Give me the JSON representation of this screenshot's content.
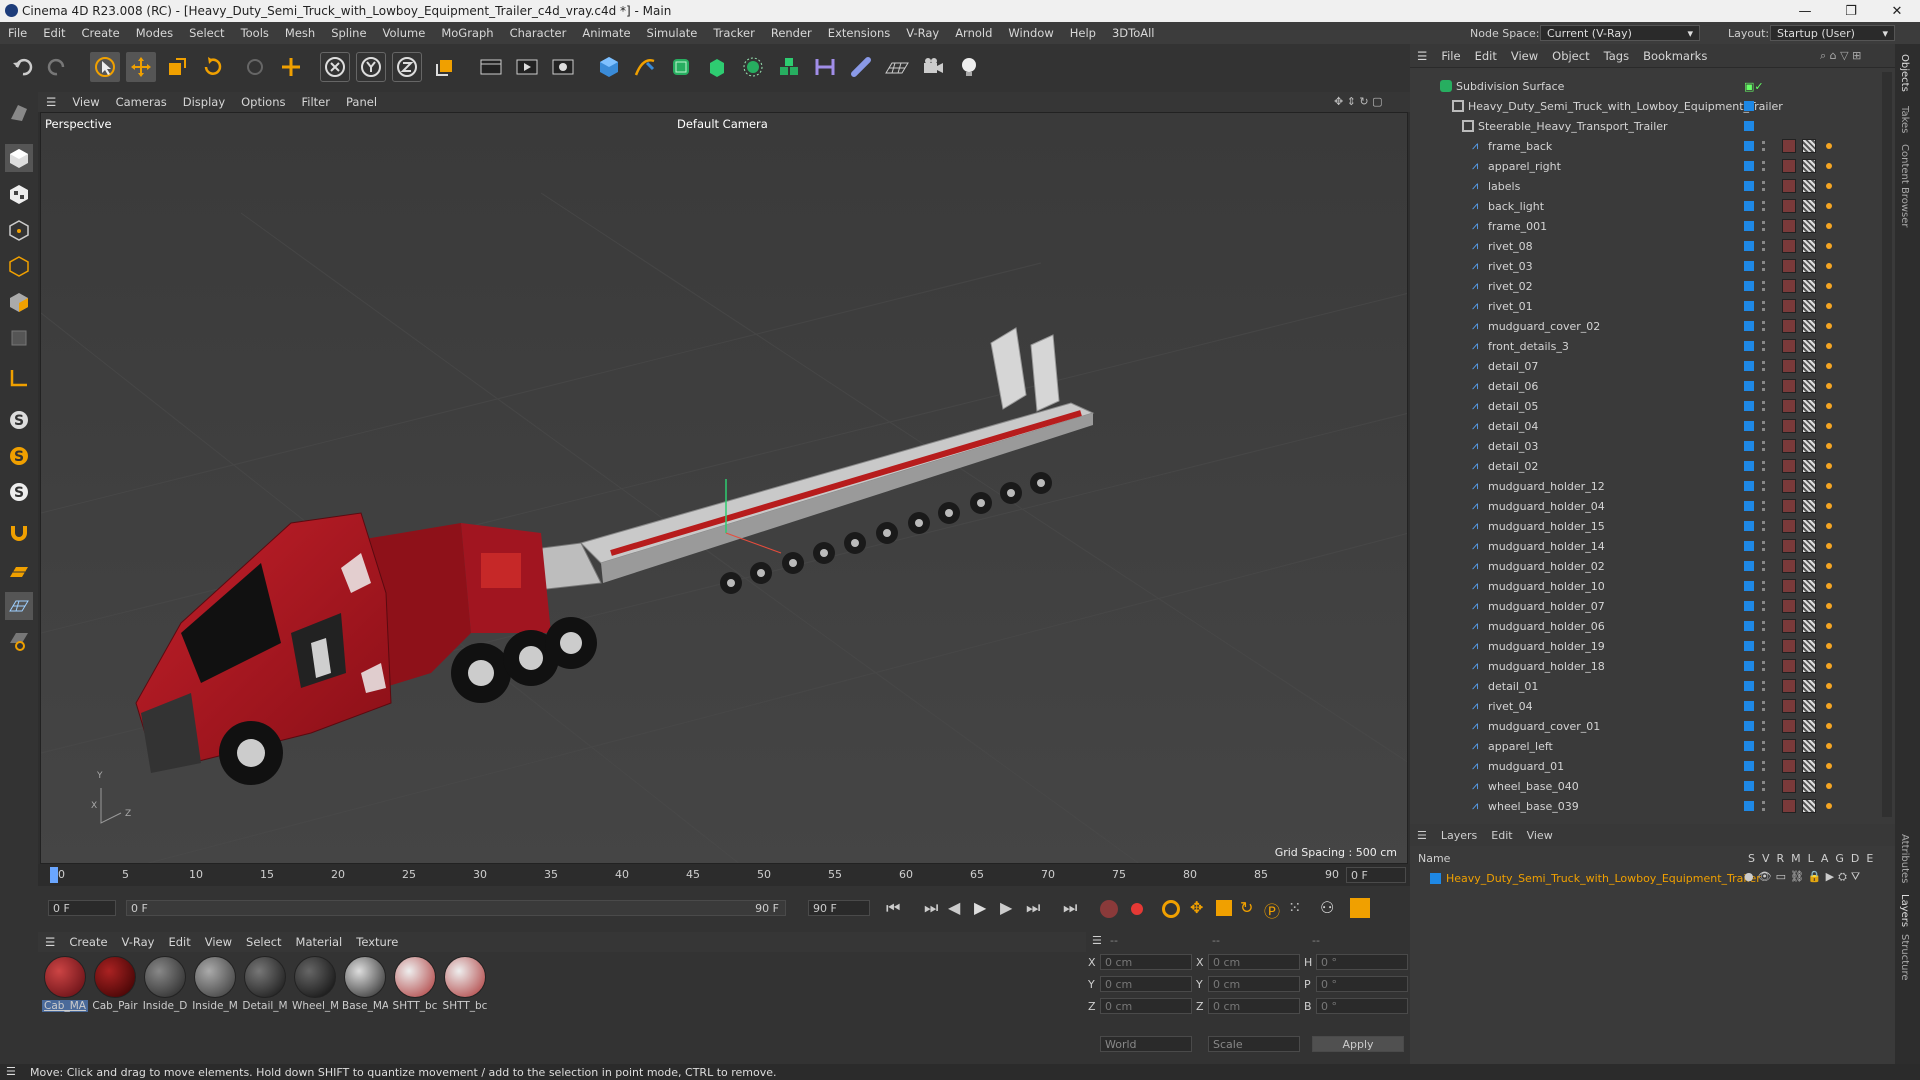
{
  "window": {
    "title": "Cinema 4D R23.008 (RC) - [Heavy_Duty_Semi_Truck_with_Lowboy_Equipment_Trailer_c4d_vray.c4d *] - Main",
    "minimize": "—",
    "maximize": "❐",
    "close": "✕"
  },
  "menu": [
    "File",
    "Edit",
    "Create",
    "Modes",
    "Select",
    "Tools",
    "Mesh",
    "Spline",
    "Volume",
    "MoGraph",
    "Character",
    "Animate",
    "Simulate",
    "Tracker",
    "Render",
    "Extensions",
    "V-Ray",
    "Arnold",
    "Window",
    "Help",
    "3DToAll"
  ],
  "node_space": {
    "label": "Node Space:",
    "value": "Current (V-Ray)"
  },
  "layout": {
    "label": "Layout:",
    "value": "Startup (User)"
  },
  "viewport_menu": [
    "View",
    "Cameras",
    "Display",
    "Options",
    "Filter",
    "Panel"
  ],
  "viewport": {
    "name": "Perspective",
    "camera": "Default Camera",
    "grid_spacing": "Grid Spacing : 500 cm",
    "axis_y": "Y",
    "axis_z": "Z",
    "axis_x": "X"
  },
  "timeline": {
    "ticks": [
      "0",
      "5",
      "10",
      "15",
      "20",
      "25",
      "30",
      "35",
      "40",
      "45",
      "50",
      "55",
      "60",
      "65",
      "70",
      "75",
      "80",
      "85",
      "90"
    ],
    "end_field": "0 F"
  },
  "transport": {
    "start": "0 F",
    "range_start": "0 F",
    "range_end": "90 F",
    "end": "90 F"
  },
  "material_menu": [
    "Create",
    "V-Ray",
    "Edit",
    "View",
    "Select",
    "Material",
    "Texture"
  ],
  "materials": [
    {
      "name": "Cab_MA",
      "color": "#8a1a22"
    },
    {
      "name": "Cab_Pair",
      "color": "#6a1016"
    },
    {
      "name": "Inside_D",
      "color": "#3a3a3a"
    },
    {
      "name": "Inside_M",
      "color": "#555555"
    },
    {
      "name": "Detail_M",
      "color": "#2a2a2a"
    },
    {
      "name": "Wheel_M",
      "color": "#222222"
    },
    {
      "name": "Base_MA",
      "color": "#444444"
    },
    {
      "name": "SHTT_bc",
      "color": "#b44"
    },
    {
      "name": "SHTT_bc",
      "color": "#b44"
    }
  ],
  "coords": {
    "header": [
      "--",
      "--",
      "--"
    ],
    "rows": [
      {
        "a": "X",
        "av": "0 cm",
        "b": "X",
        "bv": "0 cm",
        "c": "H",
        "cv": "0 °"
      },
      {
        "a": "Y",
        "av": "0 cm",
        "b": "Y",
        "bv": "0 cm",
        "c": "P",
        "cv": "0 °"
      },
      {
        "a": "Z",
        "av": "0 cm",
        "b": "Z",
        "bv": "0 cm",
        "c": "B",
        "cv": "0 °"
      }
    ],
    "world": "World",
    "scale": "Scale",
    "apply": "Apply"
  },
  "status": "Move: Click and drag to move elements. Hold down SHIFT to quantize movement / add to the selection in point mode, CTRL to remove.",
  "object_menu": [
    "File",
    "Edit",
    "View",
    "Object",
    "Tags",
    "Bookmarks"
  ],
  "objects": {
    "root": "Subdivision Surface",
    "level1": "Heavy_Duty_Semi_Truck_with_Lowboy_Equipment_Trailer",
    "level2": "Steerable_Heavy_Transport_Trailer",
    "children": [
      "frame_back",
      "apparel_right",
      "labels",
      "back_light",
      "frame_001",
      "rivet_08",
      "rivet_03",
      "rivet_02",
      "rivet_01",
      "mudguard_cover_02",
      "front_details_3",
      "detail_07",
      "detail_06",
      "detail_05",
      "detail_04",
      "detail_03",
      "detail_02",
      "mudguard_holder_12",
      "mudguard_holder_04",
      "mudguard_holder_15",
      "mudguard_holder_14",
      "mudguard_holder_02",
      "mudguard_holder_10",
      "mudguard_holder_07",
      "mudguard_holder_06",
      "mudguard_holder_19",
      "mudguard_holder_18",
      "detail_01",
      "rivet_04",
      "mudguard_cover_01",
      "apparel_left",
      "mudguard_01",
      "wheel_base_040",
      "wheel_base_039"
    ]
  },
  "layers_menu": [
    "Layers",
    "Edit",
    "View"
  ],
  "layers": {
    "header_name": "Name",
    "flags": [
      "S",
      "V",
      "R",
      "M",
      "L",
      "A",
      "G",
      "D",
      "E"
    ],
    "item": "Heavy_Duty_Semi_Truck_with_Lowboy_Equipment_Trailer",
    "item_color": "#1e88e5"
  },
  "side_tabs": [
    "Objects",
    "Takes",
    "Content Browser",
    "Attributes",
    "Layers",
    "Structure"
  ]
}
